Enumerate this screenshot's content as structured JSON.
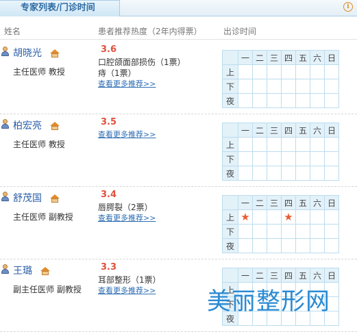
{
  "header": {
    "tab_label": "专家列表/门诊时间",
    "info_icon": "info-icon"
  },
  "columns": {
    "name": "姓名",
    "recommend": "患者推荐热度（2年内得票）",
    "schedule": "出诊时间"
  },
  "schedule_labels": {
    "days": [
      "一",
      "二",
      "三",
      "四",
      "五",
      "六",
      "日"
    ],
    "periods": [
      "上",
      "下",
      "夜"
    ]
  },
  "doctors": [
    {
      "name": "胡晓光",
      "title": "主任医师 教授",
      "score": "3.6",
      "recs": [
        "口腔颌面部损伤（1票）",
        "痔（1票）"
      ],
      "more": "查看更多推荐>>",
      "slots": {
        "上": [],
        "下": [],
        "夜": []
      }
    },
    {
      "name": "柏宏亮",
      "title": "主任医师 教授",
      "score": "3.5",
      "recs": [],
      "more": "查看更多推荐>>",
      "slots": {
        "上": [],
        "下": [],
        "夜": []
      }
    },
    {
      "name": "舒茂国",
      "title": "主任医师 副教授",
      "score": "3.4",
      "recs": [
        "唇腭裂（2票）"
      ],
      "more": "查看更多推荐>>",
      "slots": {
        "上": [
          "一",
          "四"
        ],
        "下": [],
        "夜": []
      }
    },
    {
      "name": "王璐",
      "title": "副主任医师 副教授",
      "score": "3.3",
      "recs": [
        "耳部整形（1票）"
      ],
      "more": "查看更多推荐>>",
      "slots": {
        "上": [],
        "下": [],
        "夜": []
      }
    }
  ],
  "watermark": "美丽整形网",
  "colors": {
    "accent": "#2b5fa8",
    "score": "#e0503d",
    "star": "#ea5a32",
    "watermark": "#2a8ad3"
  }
}
